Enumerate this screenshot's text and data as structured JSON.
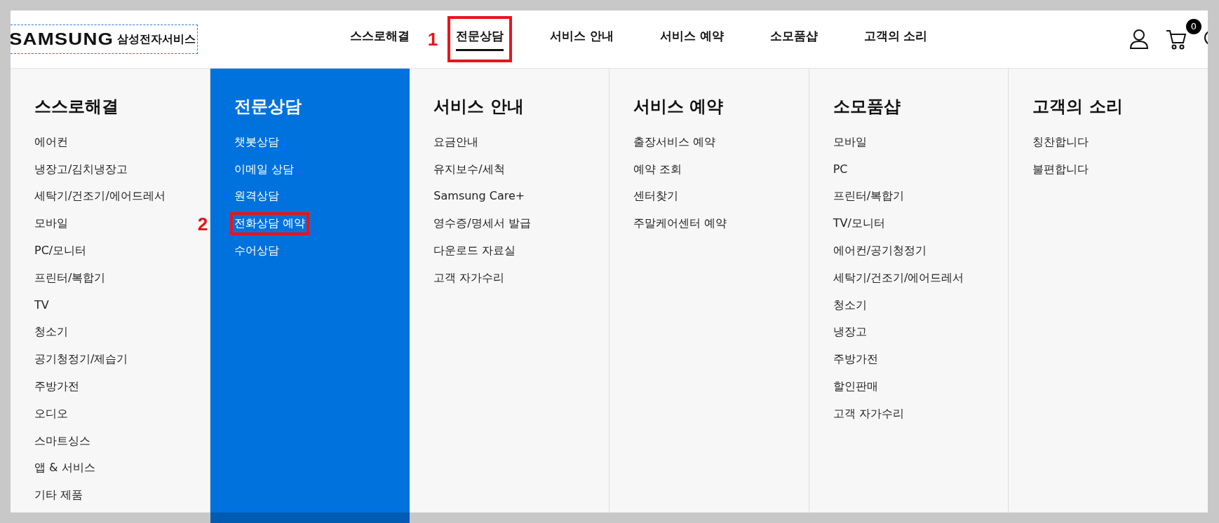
{
  "header": {
    "logo": {
      "wordmark": "SAMSUNG",
      "service": "삼성전자서비스",
      "focused": true
    },
    "nav": [
      {
        "label": "스스로해결",
        "selected": false
      },
      {
        "label": "전문상담",
        "selected": true,
        "callout": "1"
      },
      {
        "label": "서비스 안내",
        "selected": false
      },
      {
        "label": "서비스 예약",
        "selected": false
      },
      {
        "label": "소모품샵",
        "selected": false
      },
      {
        "label": "고객의 소리",
        "selected": false
      }
    ],
    "cart_count": "0"
  },
  "menu": {
    "columns": [
      {
        "title": "스스로해결",
        "selected": false,
        "items": [
          {
            "label": "에어컨"
          },
          {
            "label": "냉장고/김치냉장고"
          },
          {
            "label": "세탁기/건조기/에어드레서"
          },
          {
            "label": "모바일"
          },
          {
            "label": "PC/모니터"
          },
          {
            "label": "프린터/복합기"
          },
          {
            "label": "TV"
          },
          {
            "label": "청소기"
          },
          {
            "label": "공기청정기/제습기"
          },
          {
            "label": "주방가전"
          },
          {
            "label": "오디오"
          },
          {
            "label": "스마트싱스"
          },
          {
            "label": "앱 & 서비스"
          },
          {
            "label": "기타 제품"
          }
        ]
      },
      {
        "title": "전문상담",
        "selected": true,
        "items": [
          {
            "label": "챗봇상담"
          },
          {
            "label": "이메일 상담"
          },
          {
            "label": "원격상담"
          },
          {
            "label": "전화상담 예약",
            "callout": "2"
          },
          {
            "label": "수어상담"
          }
        ]
      },
      {
        "title": "서비스 안내",
        "selected": false,
        "items": [
          {
            "label": "요금안내"
          },
          {
            "label": "유지보수/세척"
          },
          {
            "label": "Samsung Care+"
          },
          {
            "label": "영수증/명세서 발급"
          },
          {
            "label": "다운로드 자료실"
          },
          {
            "label": "고객 자가수리"
          }
        ]
      },
      {
        "title": "서비스 예약",
        "selected": false,
        "items": [
          {
            "label": "출장서비스 예약"
          },
          {
            "label": "예약 조회"
          },
          {
            "label": "센터찾기"
          },
          {
            "label": "주말케어센터 예약"
          }
        ]
      },
      {
        "title": "소모품샵",
        "selected": false,
        "items": [
          {
            "label": "모바일"
          },
          {
            "label": "PC"
          },
          {
            "label": "프린터/복합기"
          },
          {
            "label": "TV/모니터"
          },
          {
            "label": "에어컨/공기청정기"
          },
          {
            "label": "세탁기/건조기/에어드레서"
          },
          {
            "label": "청소기"
          },
          {
            "label": "냉장고"
          },
          {
            "label": "주방가전"
          },
          {
            "label": "할인판매"
          },
          {
            "label": "고객 자가수리"
          }
        ]
      },
      {
        "title": "고객의 소리",
        "selected": false,
        "items": [
          {
            "label": "칭찬합니다"
          },
          {
            "label": "불편합니다"
          }
        ]
      }
    ]
  }
}
